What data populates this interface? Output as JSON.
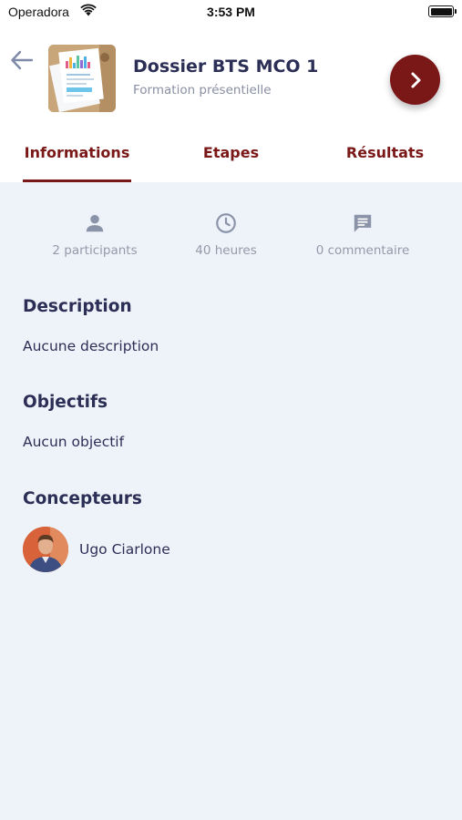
{
  "status_bar": {
    "carrier": "Operadora",
    "time": "3:53 PM"
  },
  "header": {
    "title": "Dossier BTS MCO 1",
    "subtitle": "Formation présentielle",
    "back_icon": "arrow-left-icon",
    "next_icon": "chevron-right-icon"
  },
  "tabs": [
    {
      "label": "Informations",
      "active": true
    },
    {
      "label": "Etapes",
      "active": false
    },
    {
      "label": "Résultats",
      "active": false
    }
  ],
  "stats": {
    "participants": {
      "icon": "person-icon",
      "label": "2 participants"
    },
    "duration": {
      "icon": "clock-icon",
      "label": "40 heures"
    },
    "comments": {
      "icon": "comment-icon",
      "label": "0 commentaire"
    }
  },
  "sections": {
    "description": {
      "title": "Description",
      "text": "Aucune description"
    },
    "objectives": {
      "title": "Objectifs",
      "text": "Aucun objectif"
    },
    "designers": {
      "title": "Concepteurs",
      "items": [
        {
          "name": "Ugo Ciarlone"
        }
      ]
    }
  },
  "colors": {
    "accent": "#7a1818",
    "title": "#2c2f55",
    "muted": "#9599a9",
    "background": "#eef3fa"
  }
}
